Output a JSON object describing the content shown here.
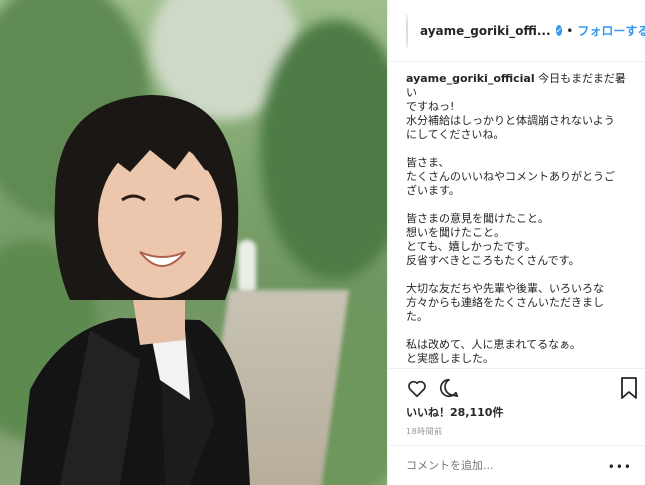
{
  "post": {
    "username": "ayame_goriki_offi...",
    "verified_icon": "verified-badge-icon",
    "separator": "•",
    "follow_label": "フォローする",
    "caption_user": "ayame_goriki_official",
    "caption_lines": [
      "今日もまだまだ暑い",
      "ですねっ!",
      "水分補給はしっかりと体調崩されないよう",
      "にしてくださいね。",
      "",
      "皆さま、",
      "たくさんのいいねやコメントありがとうご",
      "ざいます。",
      "",
      "皆さまの意見を聞けたこと。",
      "想いを聞けたこと。",
      "とても、嬉しかったです。",
      "反省すべきところもたくさんです。",
      "",
      "大切な友だちや先輩や後輩、いろいろな",
      "方々からも連絡をたくさんいただきまし",
      "た。",
      "",
      "私は改めて、人に恵まれてるなぁ。",
      "と実感しました。"
    ],
    "likes": "いいね！28,110件",
    "timestamp": "18時間前",
    "comment_placeholder": "コメントを追加...",
    "more_label": "•••"
  },
  "colors": {
    "accent": "#3897f0",
    "text": "#262626",
    "muted": "#999999",
    "border": "#efefef"
  }
}
